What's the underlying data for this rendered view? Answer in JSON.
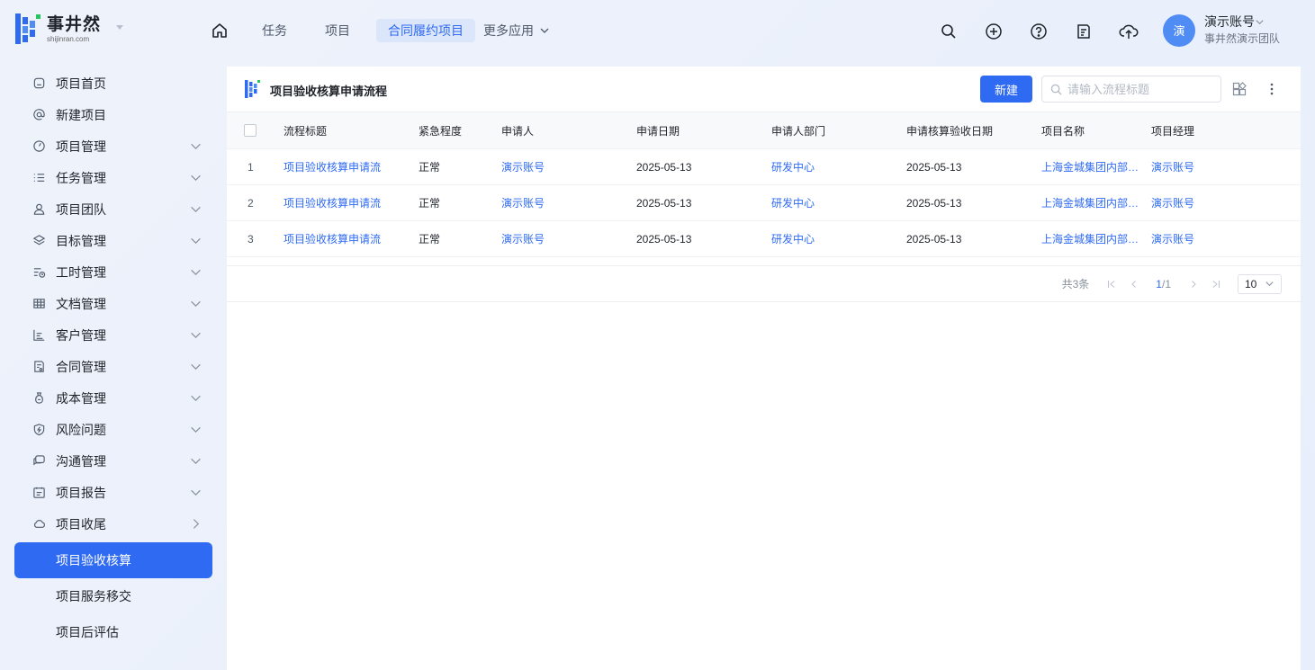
{
  "brand": {
    "title": "事井然",
    "subtitle": "shijinran.com"
  },
  "nav": {
    "home_icon": "home-icon",
    "items": [
      "任务",
      "项目",
      "合同履约项目"
    ],
    "active": "合同履约项目",
    "more_label": "更多应用"
  },
  "toolbar_icons": [
    "search-icon",
    "plus-circle-icon",
    "help-icon",
    "notes-icon",
    "cloud-upload-icon"
  ],
  "user": {
    "avatar_text": "演",
    "name": "演示账号",
    "team": "事井然演示团队",
    "avatar_color": "#4f8df5"
  },
  "sidebar": {
    "items": [
      {
        "label": "项目首页",
        "icon": "home-outline-icon",
        "chevron": "none"
      },
      {
        "label": "新建项目",
        "icon": "at-icon",
        "chevron": "none"
      },
      {
        "label": "项目管理",
        "icon": "dashboard-icon",
        "chevron": "down"
      },
      {
        "label": "任务管理",
        "icon": "list-icon",
        "chevron": "down"
      },
      {
        "label": "项目团队",
        "icon": "user-icon",
        "chevron": "down"
      },
      {
        "label": "目标管理",
        "icon": "layers-icon",
        "chevron": "down"
      },
      {
        "label": "工时管理",
        "icon": "timesheet-icon",
        "chevron": "down"
      },
      {
        "label": "文档管理",
        "icon": "table-icon",
        "chevron": "down"
      },
      {
        "label": "客户管理",
        "icon": "chart-icon",
        "chevron": "down"
      },
      {
        "label": "合同管理",
        "icon": "contract-icon",
        "chevron": "down"
      },
      {
        "label": "成本管理",
        "icon": "money-bag-icon",
        "chevron": "down"
      },
      {
        "label": "风险问题",
        "icon": "shield-icon",
        "chevron": "down"
      },
      {
        "label": "沟通管理",
        "icon": "chat-icon",
        "chevron": "down"
      },
      {
        "label": "项目报告",
        "icon": "report-icon",
        "chevron": "down"
      },
      {
        "label": "项目收尾",
        "icon": "cloud-icon",
        "chevron": "right"
      }
    ],
    "sub_items": [
      "项目验收核算",
      "项目服务移交",
      "项目后评估"
    ],
    "active_sub": "项目验收核算",
    "accent": "#2f6bf2"
  },
  "panel": {
    "title": "项目验收核算申请流程",
    "new_button": "新建",
    "search_placeholder": "请输入流程标题",
    "icons": [
      "grid-settings-icon",
      "more-vertical-icon"
    ]
  },
  "table": {
    "columns": [
      "流程标题",
      "紧急程度",
      "申请人",
      "申请日期",
      "申请人部门",
      "申请核算验收日期",
      "项目名称",
      "项目经理"
    ],
    "rows": [
      {
        "index": "1",
        "title": "项目验收核算申请流",
        "urgency": "正常",
        "applicant": "演示账号",
        "date": "2025-05-13",
        "dept": "研发中心",
        "check_date": "2025-05-13",
        "project": "上海金城集团内部数…",
        "manager": "演示账号"
      },
      {
        "index": "2",
        "title": "项目验收核算申请流",
        "urgency": "正常",
        "applicant": "演示账号",
        "date": "2025-05-13",
        "dept": "研发中心",
        "check_date": "2025-05-13",
        "project": "上海金城集团内部数…",
        "manager": "演示账号"
      },
      {
        "index": "3",
        "title": "项目验收核算申请流",
        "urgency": "正常",
        "applicant": "演示账号",
        "date": "2025-05-13",
        "dept": "研发中心",
        "check_date": "2025-05-13",
        "project": "上海金城集团内部数…",
        "manager": "演示账号"
      }
    ]
  },
  "pagination": {
    "total": "共3条",
    "current": "1",
    "pages": "/1",
    "page_size": "10"
  }
}
